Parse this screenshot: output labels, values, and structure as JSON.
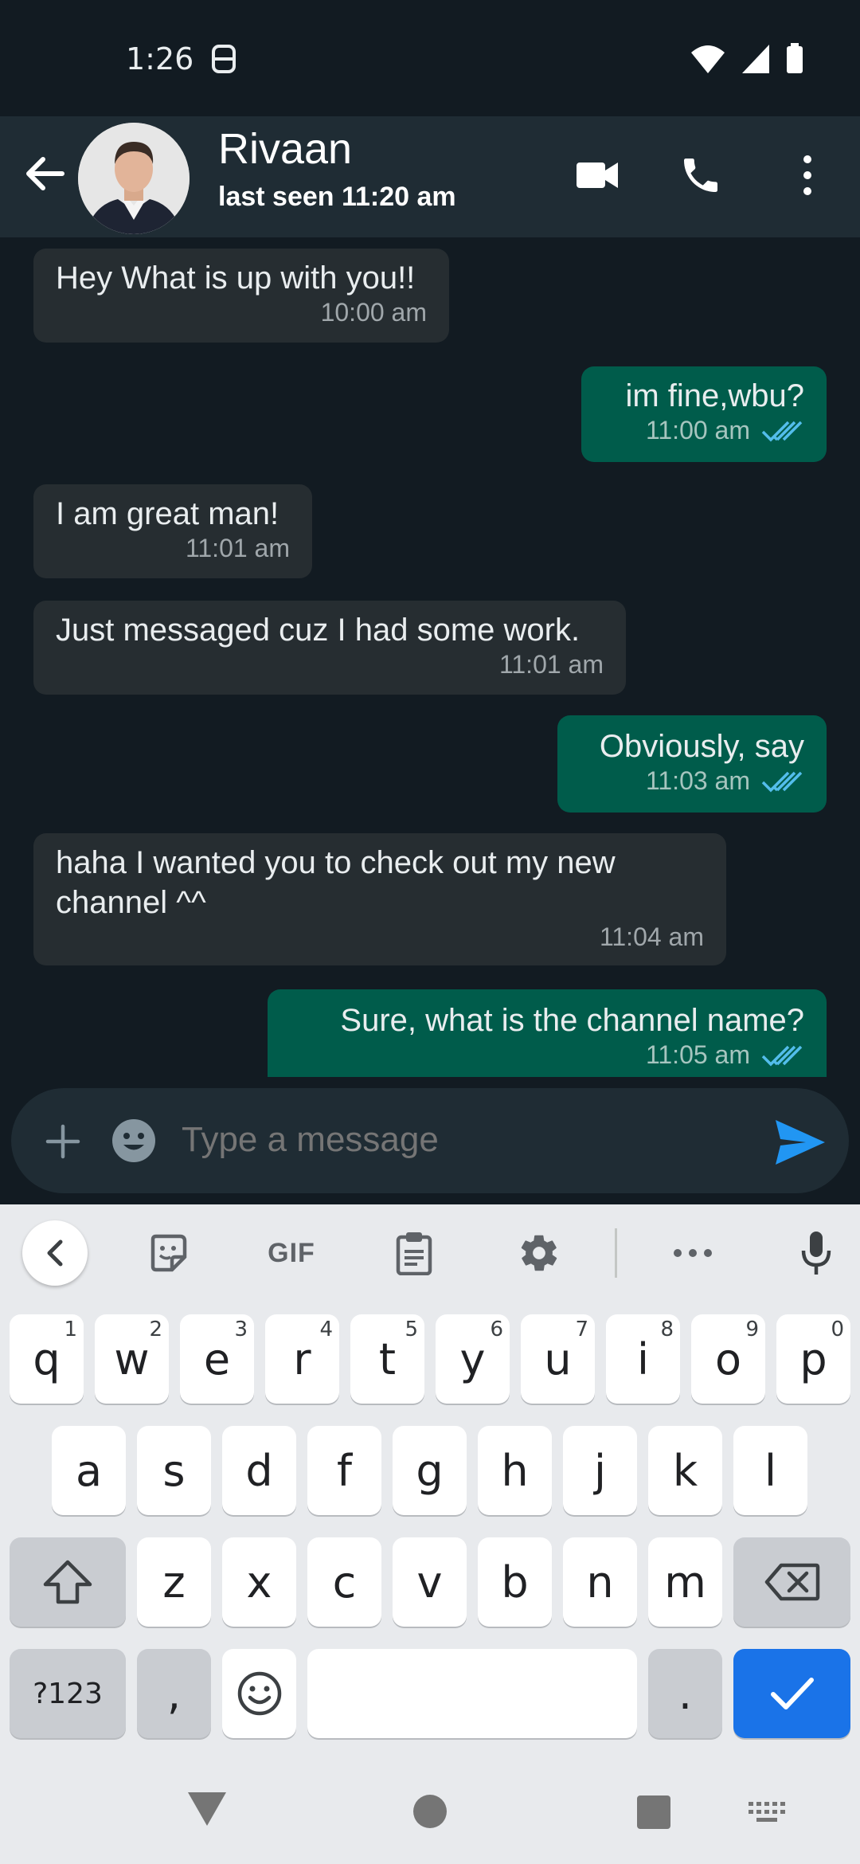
{
  "status_bar": {
    "time": "1:26"
  },
  "header": {
    "contact_name": "Rivaan",
    "last_seen": "last seen 11:20 am"
  },
  "messages": [
    {
      "direction": "in",
      "text": "Hey What is up with you!!",
      "time": "10:00 am"
    },
    {
      "direction": "out",
      "text": "im fine,wbu?",
      "time": "11:00 am",
      "read": true
    },
    {
      "direction": "in",
      "text": "I am great man!",
      "time": "11:01 am"
    },
    {
      "direction": "in",
      "text": "Just messaged cuz I had some work.",
      "time": "11:01 am"
    },
    {
      "direction": "out",
      "text": "Obviously, say",
      "time": "11:03 am",
      "read": true
    },
    {
      "direction": "in",
      "text": "haha I wanted you to check out my new channel ^^",
      "time": "11:04 am"
    },
    {
      "direction": "out",
      "text": "Sure, what is the channel name?",
      "time": "11:05 am",
      "read": true
    }
  ],
  "composer": {
    "placeholder": "Type a message"
  },
  "keyboard": {
    "toolbar_gif": "GIF",
    "row1": [
      {
        "key": "q",
        "hint": "1"
      },
      {
        "key": "w",
        "hint": "2"
      },
      {
        "key": "e",
        "hint": "3"
      },
      {
        "key": "r",
        "hint": "4"
      },
      {
        "key": "t",
        "hint": "5"
      },
      {
        "key": "y",
        "hint": "6"
      },
      {
        "key": "u",
        "hint": "7"
      },
      {
        "key": "i",
        "hint": "8"
      },
      {
        "key": "o",
        "hint": "9"
      },
      {
        "key": "p",
        "hint": "0"
      }
    ],
    "row2": [
      "a",
      "s",
      "d",
      "f",
      "g",
      "h",
      "j",
      "k",
      "l"
    ],
    "row3": [
      "z",
      "x",
      "c",
      "v",
      "b",
      "n",
      "m"
    ],
    "symbols_label": "?123",
    "comma": ",",
    "period": "."
  },
  "colors": {
    "background": "#121b22",
    "header": "#1f2c34",
    "incoming_bubble": "#262d31",
    "outgoing_bubble": "#005c4b",
    "read_ticks": "#53bdeb",
    "send_accent": "#2196f3",
    "keyboard_accent": "#1a73e8"
  }
}
